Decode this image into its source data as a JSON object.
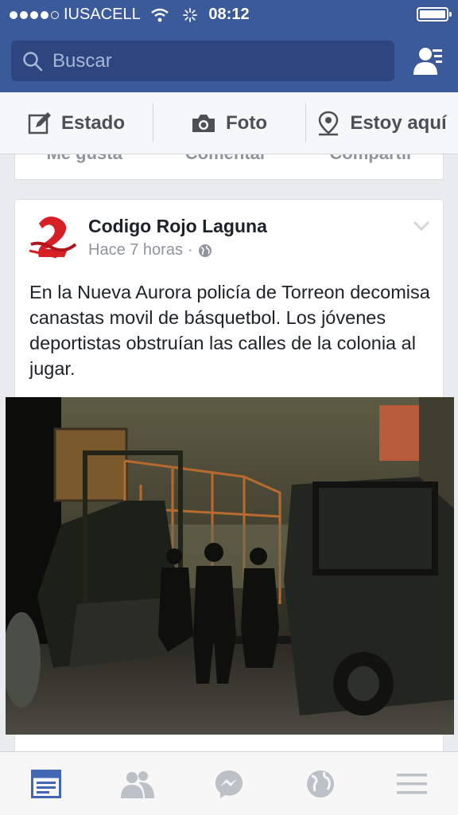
{
  "status_bar": {
    "carrier": "IUSACELL",
    "time": "08:12"
  },
  "search": {
    "placeholder": "Buscar"
  },
  "composer": {
    "items": [
      {
        "label": "Estado",
        "icon": "pencil-icon"
      },
      {
        "label": "Foto",
        "icon": "camera-icon"
      },
      {
        "label": "Estoy aquí",
        "icon": "location-pin-icon"
      }
    ]
  },
  "previous_post_actions": [
    "Me gusta",
    "Comentar",
    "Compartir"
  ],
  "post": {
    "author": "Codigo Rojo Laguna",
    "time": "Hace 7 horas",
    "separator": "·",
    "text": "En la Nueva Aurora policía de Torreon decomisa canastas movil de básquetbol. Los jóvenes deportistas obstruían las calles de la colonia al jugar."
  },
  "tabbar": {
    "items": [
      "news-feed-icon",
      "friend-requests-icon",
      "messenger-icon",
      "notifications-globe-icon",
      "more-menu-icon"
    ],
    "active_index": 0
  },
  "colors": {
    "header_blue": "#3b5a9a",
    "active_tab": "#4267b2",
    "inactive_tab": "#bcc0c7"
  }
}
